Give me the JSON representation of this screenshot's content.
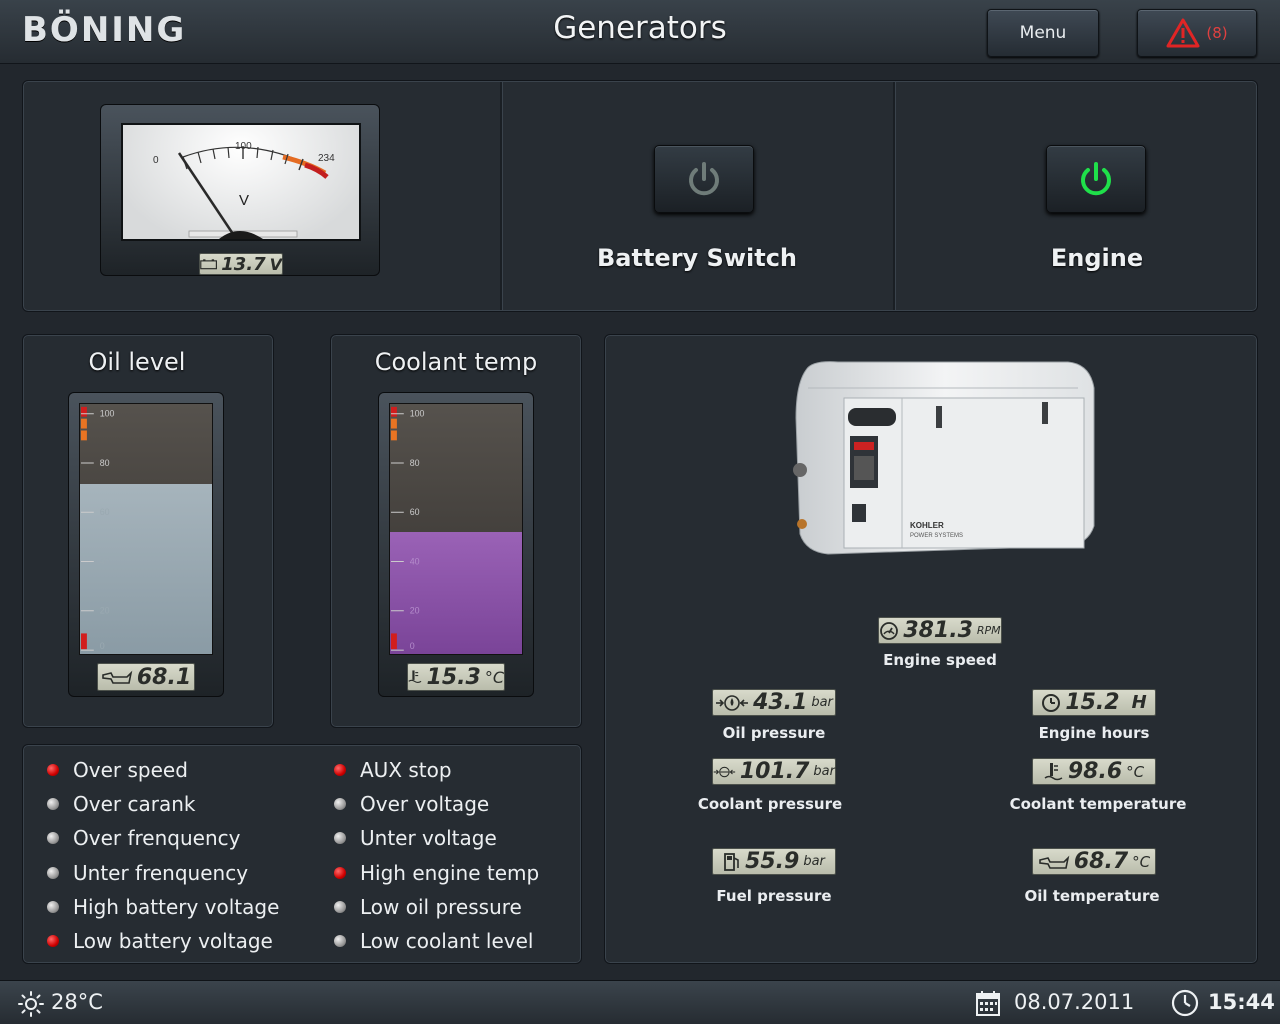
{
  "header": {
    "brand": "BÖNING",
    "title": "Generators",
    "menu_label": "Menu",
    "alarm_count": "(8)"
  },
  "voltmeter": {
    "scale_min": "0",
    "scale_mid": "100",
    "scale_max": "234",
    "unit_symbol": "V",
    "reading": "13.7",
    "reading_unit": "V"
  },
  "switches": {
    "battery_label": "Battery Switch",
    "battery_state": "off",
    "engine_label": "Engine",
    "engine_state": "on"
  },
  "oil_level": {
    "title": "Oil level",
    "value": "68.1",
    "fill_percent": 68.1,
    "ticks": [
      "100",
      "80",
      "60",
      "40",
      "20",
      "0"
    ]
  },
  "coolant_temp": {
    "title": "Coolant temp",
    "value": "15.3",
    "unit": "°C",
    "fill_percent": 49,
    "ticks": [
      "100",
      "80",
      "60",
      "40",
      "20",
      "0"
    ]
  },
  "alarms": {
    "left": [
      {
        "label": "Over speed",
        "active": true
      },
      {
        "label": "Over carank",
        "active": false
      },
      {
        "label": "Over frenquency",
        "active": false
      },
      {
        "label": "Unter frenquency",
        "active": false
      },
      {
        "label": "High battery voltage",
        "active": false
      },
      {
        "label": "Low battery voltage",
        "active": true
      }
    ],
    "right": [
      {
        "label": "AUX stop",
        "active": true
      },
      {
        "label": "Over voltage",
        "active": false
      },
      {
        "label": "Unter voltage",
        "active": false
      },
      {
        "label": "High engine temp",
        "active": true
      },
      {
        "label": "Low oil pressure",
        "active": false
      },
      {
        "label": "Low coolant level",
        "active": false
      }
    ]
  },
  "generator": {
    "brand_text": "KOHLER",
    "brand_sub": "POWER SYSTEMS"
  },
  "metrics": {
    "engine_speed": {
      "value": "381.3",
      "unit": "RPM",
      "label": "Engine speed"
    },
    "oil_pressure": {
      "value": "43.1",
      "unit": "bar",
      "label": "Oil pressure"
    },
    "engine_hours": {
      "value": "15.2",
      "unit": "H",
      "label": "Engine hours"
    },
    "coolant_pressure": {
      "value": "101.7",
      "unit": "bar",
      "label": "Coolant pressure"
    },
    "coolant_temperature": {
      "value": "98.6",
      "unit": "°C",
      "label": "Coolant temperature"
    },
    "fuel_pressure": {
      "value": "55.9",
      "unit": "bar",
      "label": "Fuel pressure"
    },
    "oil_temperature": {
      "value": "68.7",
      "unit": "°C",
      "label": "Oil temperature"
    }
  },
  "status": {
    "outside_temp": "28°C",
    "date": "08.07.2011",
    "time": "15:44"
  },
  "colors": {
    "alarm_red": "#d00000",
    "engine_on_green": "#1fe04a",
    "battery_off_gray": "#6f7c79",
    "oil_fill": "#8a9ba5",
    "coolant_fill": "#8b55a8"
  }
}
